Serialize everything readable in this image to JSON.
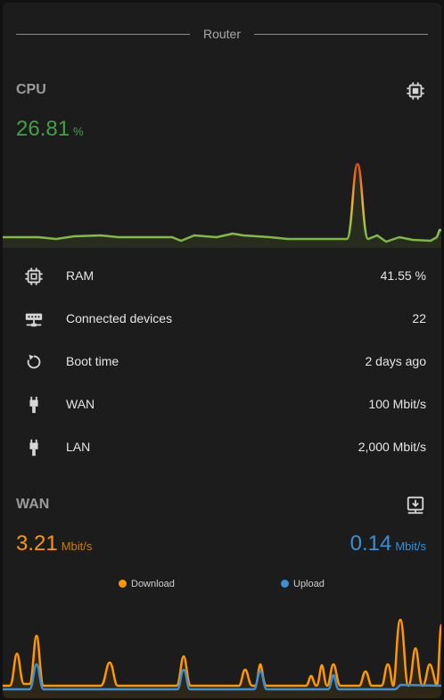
{
  "header": {
    "title": "Router"
  },
  "cpu": {
    "title": "CPU",
    "value": "26.81",
    "unit": "%",
    "icon": "chip-icon"
  },
  "stats": [
    {
      "icon": "memory-icon",
      "label": "RAM",
      "value": "41.55 %"
    },
    {
      "icon": "network-devices-icon",
      "label": "Connected devices",
      "value": "22"
    },
    {
      "icon": "restart-icon",
      "label": "Boot time",
      "value": "2 days ago"
    },
    {
      "icon": "ethernet-cable-icon",
      "label": "WAN",
      "value": "100 Mbit/s"
    },
    {
      "icon": "ethernet-cable-icon",
      "label": "LAN",
      "value": "2,000 Mbit/s"
    }
  ],
  "wan": {
    "title": "WAN",
    "icon": "download-network-icon",
    "download": {
      "value": "3.21",
      "unit": "Mbit/s",
      "color": "#ff9800"
    },
    "upload": {
      "value": "0.14",
      "unit": "Mbit/s",
      "color": "#3a8fd6"
    },
    "legend": {
      "download_label": "Download",
      "upload_label": "Upload"
    }
  },
  "colors": {
    "background": "#1c1c1c",
    "cpu_green": "#43a047",
    "cpu_peak": "#e64a19",
    "download": "#ff9800",
    "upload": "#3a8fd6"
  }
}
